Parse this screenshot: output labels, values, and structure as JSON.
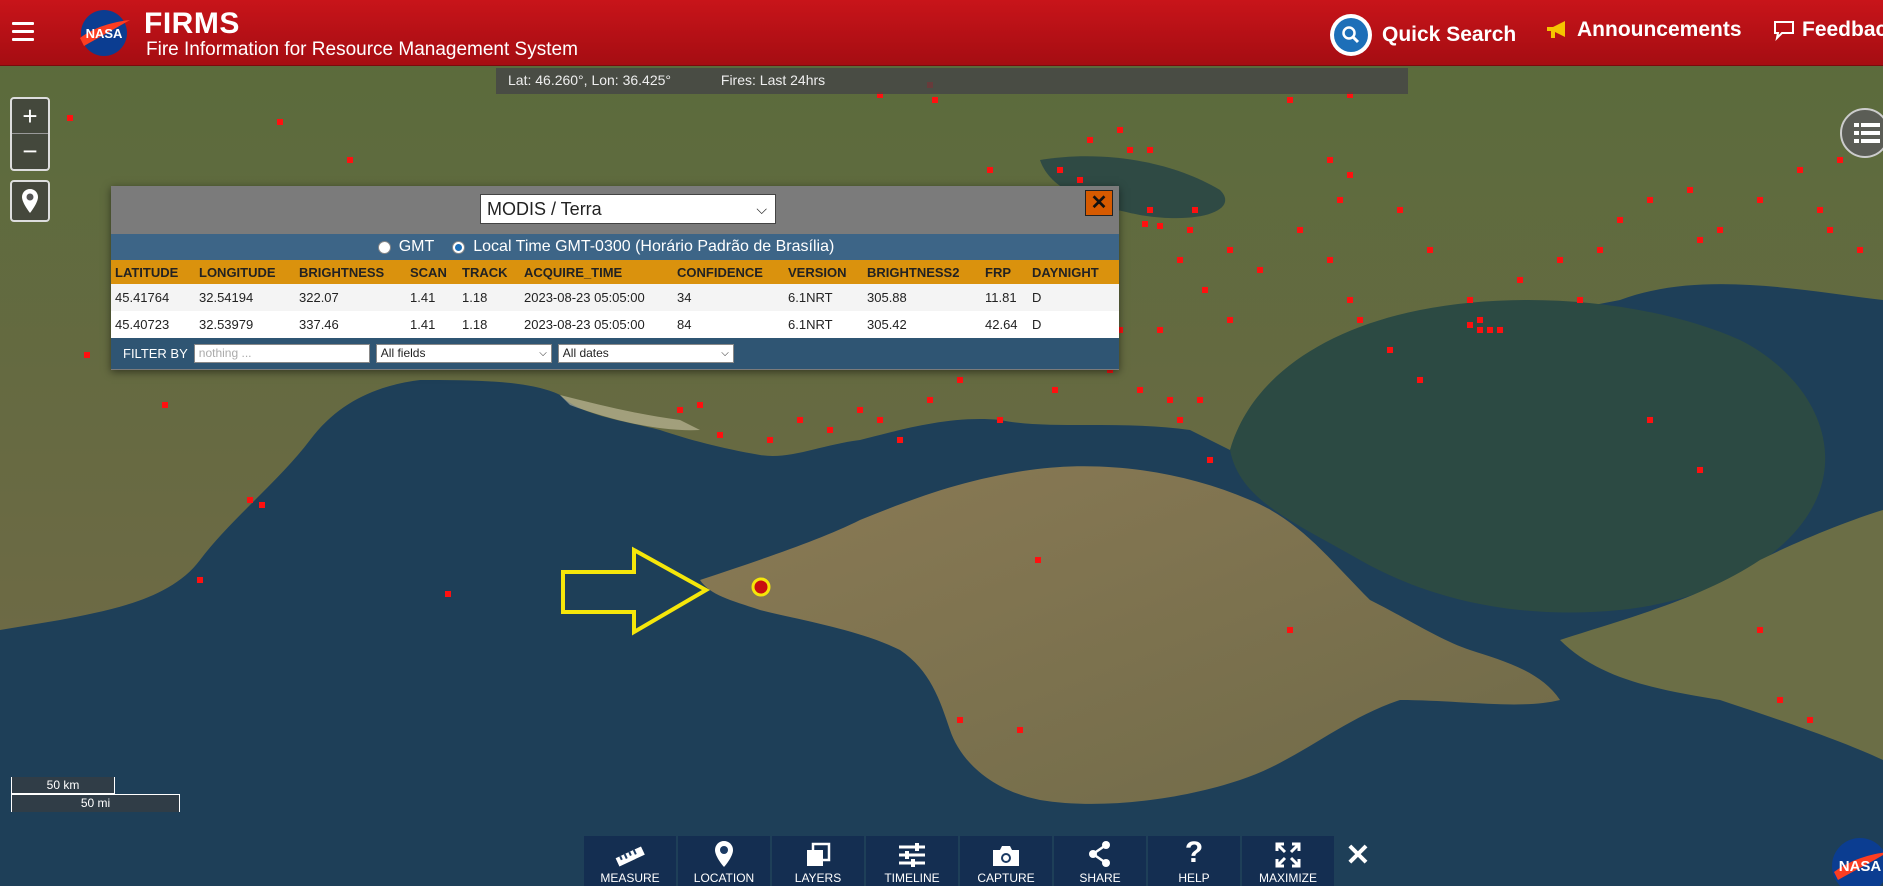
{
  "header": {
    "title": "FIRMS",
    "subtitle": "Fire Information for Resource Management System",
    "quick_search": "Quick Search",
    "announcements": "Announcements",
    "feedback": "Feedback"
  },
  "status": {
    "coords": "Lat: 46.260°, Lon: 36.425°",
    "fires": "Fires: Last 24hrs"
  },
  "scale": {
    "km": "50 km",
    "mi": "50 mi"
  },
  "popup": {
    "sensor": "MODIS / Terra",
    "tz_gmt": "GMT",
    "tz_local": "Local Time GMT-0300 (Horário Padrão de Brasília)",
    "columns": [
      "LATITUDE",
      "LONGITUDE",
      "BRIGHTNESS",
      "SCAN",
      "TRACK",
      "ACQUIRE_TIME",
      "CONFIDENCE",
      "VERSION",
      "BRIGHTNESS2",
      "FRP",
      "DAYNIGHT"
    ],
    "rows": [
      [
        "45.41764",
        "32.54194",
        "322.07",
        "1.41",
        "1.18",
        "2023-08-23 05:05:00",
        "34",
        "6.1NRT",
        "305.88",
        "11.81",
        "D"
      ],
      [
        "45.40723",
        "32.53979",
        "337.46",
        "1.41",
        "1.18",
        "2023-08-23 05:05:00",
        "84",
        "6.1NRT",
        "305.42",
        "42.64",
        "D"
      ]
    ],
    "filter_label": "FILTER BY",
    "filter_placeholder": "nothing ...",
    "field_select": "All fields",
    "date_select": "All dates"
  },
  "toolbar": {
    "measure": "MEASURE",
    "location": "LOCATION",
    "layers": "LAYERS",
    "timeline": "TIMELINE",
    "capture": "CAPTURE",
    "share": "SHARE",
    "help": "HELP",
    "maximize": "MAXIMIZE"
  },
  "colors": {
    "header_red": "#b8111a",
    "fire_dot": "#ff1010",
    "table_header": "#da920d",
    "popup_band": "#3d6587",
    "highlight_arrow": "#f5e60a"
  },
  "icons": {
    "menu": "hamburger-icon",
    "quick_search": "magnifier-icon",
    "announcements": "megaphone-icon",
    "feedback": "chat-icon",
    "zoom_in": "plus-icon",
    "zoom_out": "minus-icon",
    "locate": "map-pin-icon",
    "layers_panel": "list-icon"
  }
}
